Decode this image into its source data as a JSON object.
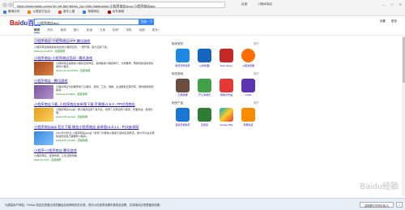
{
  "browser": {
    "url": "https://www.baidu.com/s?ie=utf-8&f=8&rsv_bp=1&tn=baidu&wd=小程序商店&oq=小程序商店app",
    "tabs": [
      "百度",
      "小程序商店"
    ],
    "bookmarks": [
      {
        "label": "最常访问",
        "color": "#3b7dd8"
      },
      {
        "label": "火狐官方站点",
        "color": "#ff7a00"
      },
      {
        "label": "新手上路",
        "color": "#e74c3c"
      },
      {
        "label": "常用网址",
        "color": "#3b7dd8"
      },
      {
        "label": "京东商城",
        "color": "#c00000"
      }
    ]
  },
  "header": {
    "logo_left": "Bai",
    "logo_right": "du百度",
    "search_value": "小程序商店app",
    "search_button": "百度一下",
    "nav_tabs": [
      "网页",
      "资讯",
      "视频",
      "图片",
      "知道",
      "文库",
      "贴吧",
      "采购",
      "地图",
      "更多»"
    ],
    "top_links": [
      "设置",
      "登录"
    ]
  },
  "stats": "百度为您找到相关结果约1,320,000个",
  "results": [
    {
      "title": "小程序商店-小程序商店APP 腾讯游戏",
      "desc": "小程序商店提供最新最全的小程序应用，一键开通，官方正版下载。",
      "url": "www.qq.com/xcx  - 百度快照",
      "thumb": ""
    },
    {
      "title": "小程序商店-小程序商店官网 - 腾讯游戏",
      "desc": "小程序商店是微信小程序应用商店，提供各类小程序排行、分类推荐，帮助您快速找到好用的小程序。",
      "url": "weixin.qq.com/shop  - 百度快照",
      "thumb": "#a04a20"
    },
    {
      "title": "小程序商店 - 腾讯游戏",
      "desc": "小程序商店为您推荐热门小程序，游戏、工具、购物、生活服务应有尽有，随时随地轻松使用。",
      "url": "www.qq.com/app  - 百度快照",
      "thumb": "#7a5a9a"
    },
    {
      "title": "小程序商店下载_小程序商店安卓版下载 苹果版v1.5.0 - PP应用商店",
      "desc": "小程序商店app是一款小程序应用下载平台，收录了大量优质小程序，界面简洁，使用方便。",
      "url": "www.pc6.com/az/  - 百度快照",
      "thumb": "#e0a020"
    },
    {
      "title": "小程序商店app 官方下载 微信小程序商店 安卓版v1.5.1.1 - PC6安卓网",
      "desc": "2017年9月5日 小程序商店app是一款专门为微信小程序打造的应用商店，用户可以在这里快速找到自己需要的小程序。",
      "url": "www.pc6.com/az/  - 百度快照",
      "thumb": "#3a8ad8"
    },
    {
      "title": "小程序-小程序商店 腾讯游戏",
      "desc": "小程序商店，连接你我，让生活更简单。",
      "url": "www.qq.com/  - 百度快照",
      "thumb": ""
    }
  ],
  "side_panel": [
    {
      "heading": "相关软件",
      "more": "展开",
      "apps": [
        {
          "name": "腾讯手机管家",
          "color": "#1e88e5"
        },
        {
          "name": "qq浏览器",
          "color": "#1565c0"
        },
        {
          "name": "flash player",
          "color": "#c62828"
        },
        {
          "name": "火狐浏览器",
          "color": "#ff6d00"
        }
      ]
    },
    {
      "heading": "相关游戏",
      "more": "展开",
      "apps": [
        {
          "name": "王者荣耀",
          "color": "#6d4c41"
        },
        {
          "name": "开心消消乐",
          "color": "#43a047"
        },
        {
          "name": "球球大作战",
          "color": "#e53935"
        },
        {
          "name": "nba2k",
          "color": "#5e35b1"
        }
      ]
    },
    {
      "heading": "相关产品",
      "more": "展开",
      "apps": [
        {
          "name": "百度手机助手",
          "color": "#1976d2"
        },
        {
          "name": "应用宝",
          "color": "#2e7d32"
        },
        {
          "name": "Google Play",
          "color": "#00acc1"
        },
        {
          "name": "苹果商店",
          "color": "#fb8c00"
        }
      ]
    }
  ],
  "notice": {
    "text": "为提高用户体验，Firefox 将会在您退出浏览器后自动清除历史记录。您可以在选项设置中更改该设置，并非绝对必须遵循该设置。",
    "btn_primary": "选择要分享的信息(C)",
    "btn_close": "×"
  },
  "watermark": "Baidu经验"
}
